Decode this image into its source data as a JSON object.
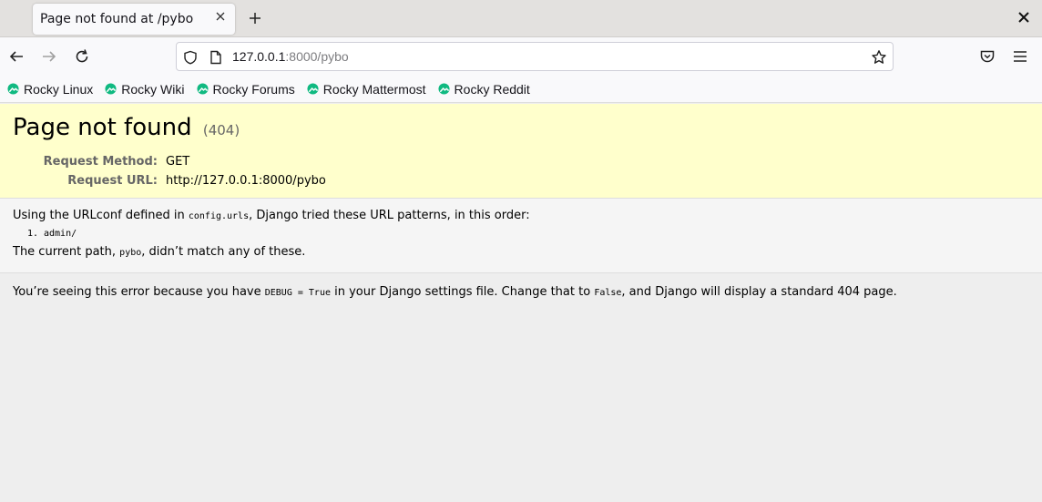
{
  "browser": {
    "tab_title": "Page not found at /pybo",
    "tab_close_icon": "close-icon",
    "new_tab_icon": "plus-icon",
    "window_close_icon": "close-icon",
    "url_host": "127.0.0.1",
    "url_rest": ":8000/pybo",
    "bookmarks": [
      {
        "label": "Rocky Linux",
        "icon": "rocky-logo-icon"
      },
      {
        "label": "Rocky Wiki",
        "icon": "rocky-logo-icon"
      },
      {
        "label": "Rocky Forums",
        "icon": "rocky-logo-icon"
      },
      {
        "label": "Rocky Mattermost",
        "icon": "rocky-logo-icon"
      },
      {
        "label": "Rocky Reddit",
        "icon": "rocky-logo-icon"
      }
    ],
    "accent_bookmark_color": "#10b981"
  },
  "page": {
    "heading": "Page not found",
    "status_code": "(404)",
    "request_method_label": "Request Method:",
    "request_method_value": "GET",
    "request_url_label": "Request URL:",
    "request_url_value": "http://127.0.0.1:8000/pybo",
    "info_intro_pre": "Using the URLconf defined in ",
    "info_intro_code": "config.urls",
    "info_intro_post": ", Django tried these URL patterns, in this order:",
    "url_patterns": [
      "admin/"
    ],
    "current_path_pre": "The current path, ",
    "current_path_code": "pybo",
    "current_path_post": ", didn’t match any of these.",
    "explanation_pre": "You’re seeing this error because you have ",
    "explanation_code1": "DEBUG = True",
    "explanation_mid": " in your Django settings file. Change that to ",
    "explanation_code2": "False",
    "explanation_post": ", and Django will display a standard 404 page.",
    "summary_bg": "#ffffcc"
  }
}
